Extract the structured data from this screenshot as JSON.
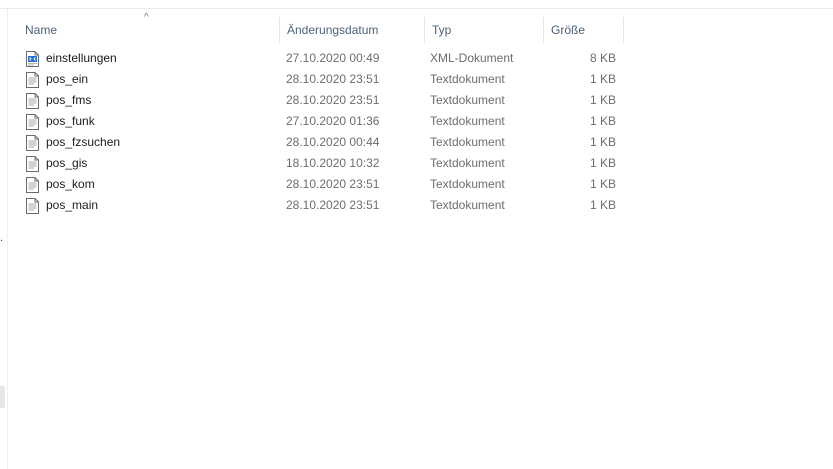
{
  "header": {
    "name": "Name",
    "date": "Änderungsdatum",
    "type": "Typ",
    "size": "Größe",
    "sort_indicator": "^"
  },
  "left_fragment": ".",
  "files": [
    {
      "name": "einstellungen",
      "date": "27.10.2020 00:49",
      "type": "XML-Dokument",
      "size": "8 KB",
      "icon": "xml-file-icon"
    },
    {
      "name": "pos_ein",
      "date": "28.10.2020 23:51",
      "type": "Textdokument",
      "size": "1 KB",
      "icon": "text-file-icon"
    },
    {
      "name": "pos_fms",
      "date": "28.10.2020 23:51",
      "type": "Textdokument",
      "size": "1 KB",
      "icon": "text-file-icon"
    },
    {
      "name": "pos_funk",
      "date": "27.10.2020 01:36",
      "type": "Textdokument",
      "size": "1 KB",
      "icon": "text-file-icon"
    },
    {
      "name": "pos_fzsuchen",
      "date": "28.10.2020 00:44",
      "type": "Textdokument",
      "size": "1 KB",
      "icon": "text-file-icon"
    },
    {
      "name": "pos_gis",
      "date": "18.10.2020 10:32",
      "type": "Textdokument",
      "size": "1 KB",
      "icon": "text-file-icon"
    },
    {
      "name": "pos_kom",
      "date": "28.10.2020 23:51",
      "type": "Textdokument",
      "size": "1 KB",
      "icon": "text-file-icon"
    },
    {
      "name": "pos_main",
      "date": "28.10.2020 23:51",
      "type": "Textdokument",
      "size": "1 KB",
      "icon": "text-file-icon"
    }
  ],
  "colors": {
    "header_text": "#4c607a",
    "meta_text": "#6d6d6d",
    "xml_icon_accent": "#2a6fc9"
  }
}
